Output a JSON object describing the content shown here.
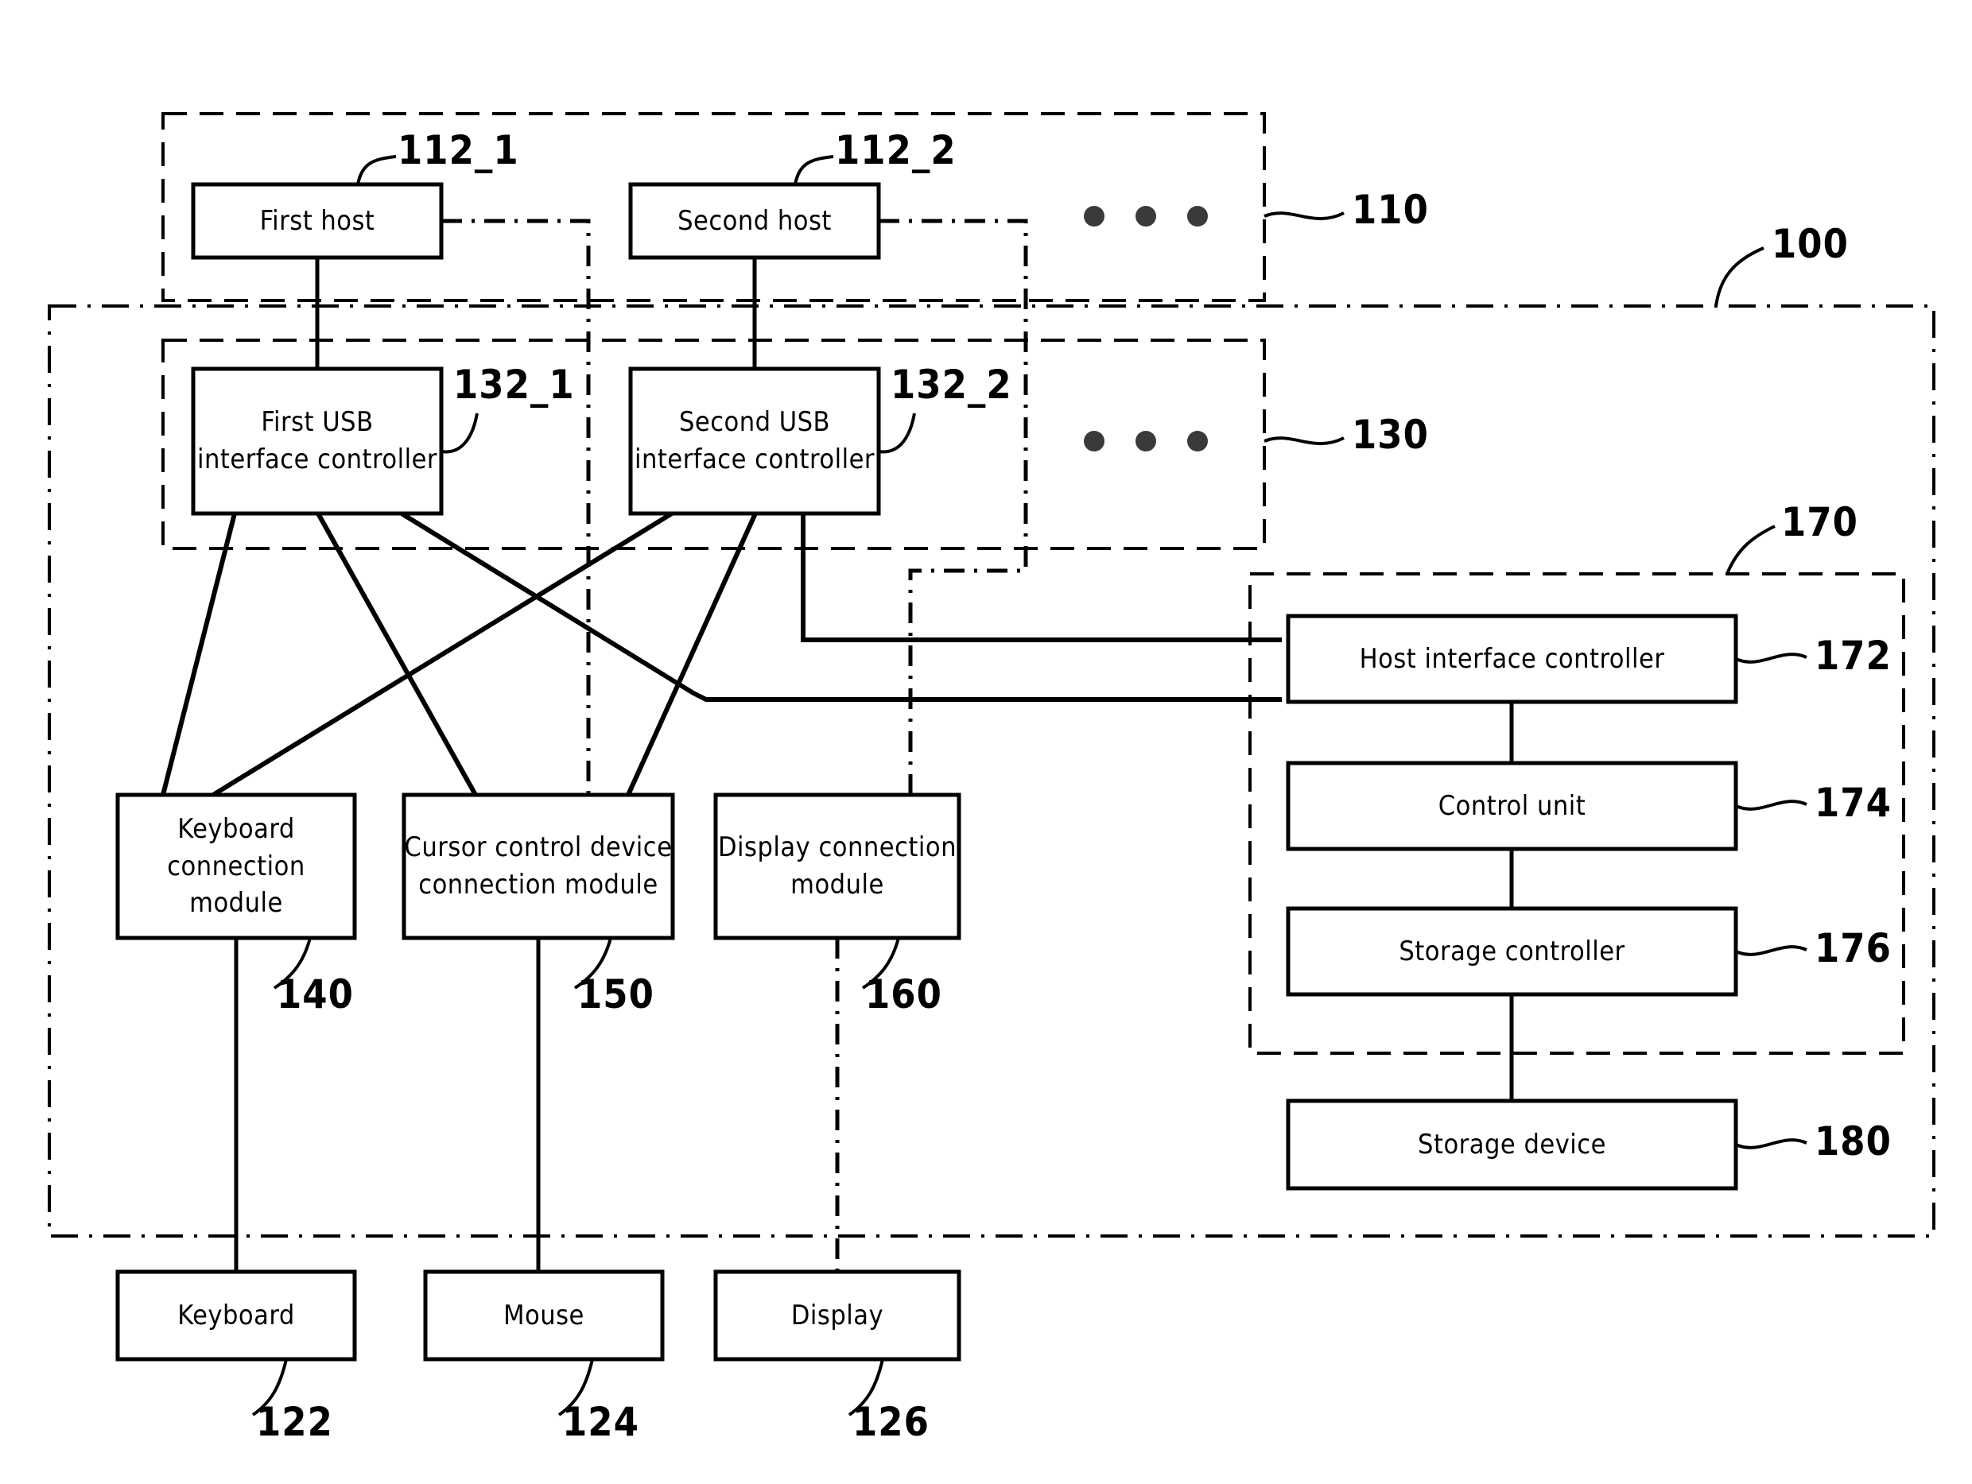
{
  "figure": {
    "type": "patent-block-diagram",
    "outer_ref": "100",
    "group_host_ref": "110",
    "group_usb_ref": "130",
    "group_kvm_storage_ref": "170"
  },
  "hosts": {
    "first_host": {
      "label": "First host",
      "ref": "112_1"
    },
    "second_host": {
      "label": "Second host",
      "ref": "112_2"
    },
    "ellipsis": "● ● ●",
    "group_ref": "110"
  },
  "usb_controllers": {
    "first": {
      "label": "First USB\ninterface controller",
      "ref": "132_1"
    },
    "second": {
      "label": "Second USB\ninterface controller",
      "ref": "132_2"
    },
    "ellipsis": "● ● ●",
    "group_ref": "130"
  },
  "connection_modules": [
    {
      "label": "Keyboard\nconnection module",
      "ref": "140",
      "name": "keyboard-connection-module"
    },
    {
      "label": "Cursor control device\nconnection module",
      "ref": "150",
      "name": "cursor-control-device-connection-module"
    },
    {
      "label": "Display connection\nmodule",
      "ref": "160",
      "name": "display-connection-module"
    }
  ],
  "peripherals": [
    {
      "label": "Keyboard",
      "ref": "122",
      "name": "keyboard"
    },
    {
      "label": "Mouse",
      "ref": "124",
      "name": "mouse"
    },
    {
      "label": "Display",
      "ref": "126",
      "name": "display"
    }
  ],
  "storage_block": {
    "group_ref": "170",
    "items": [
      {
        "label": "Host interface controller",
        "ref": "172",
        "name": "host-interface-controller"
      },
      {
        "label": "Control unit",
        "ref": "174",
        "name": "control-unit"
      },
      {
        "label": "Storage controller",
        "ref": "176",
        "name": "storage-controller"
      }
    ],
    "storage_device": {
      "label": "Storage device",
      "ref": "180",
      "name": "storage-device"
    }
  },
  "colors": {
    "stroke": "#000000",
    "background": "#ffffff"
  }
}
